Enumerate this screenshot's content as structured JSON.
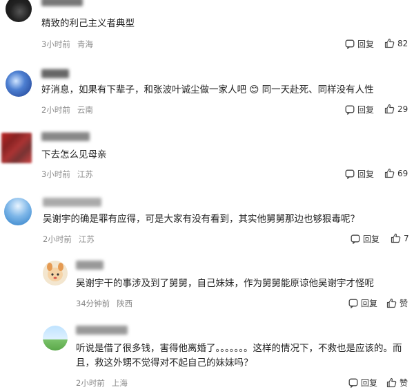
{
  "comments": [
    {
      "text": "精致的利己主义者典型",
      "time": "3小时前",
      "location": "青海",
      "reply": "回复",
      "likes": "82"
    },
    {
      "text": "好消息，如果有下辈子，和张波叶诚尘做一家人吧 😊 同一天赴死、同样没有人性",
      "time": "2小时前",
      "location": "云南",
      "reply": "回复",
      "likes": "29"
    },
    {
      "text": "下去怎么见母亲",
      "time": "3小时前",
      "location": "江苏",
      "reply": "回复",
      "likes": "69"
    },
    {
      "text": "吴谢宇的确是罪有应得，可是大家有没有看到，其实他舅舅那边也够狠毒呢？",
      "time": "2小时前",
      "location": "江苏",
      "reply": "回复",
      "likes": "7"
    },
    {
      "text": "吴谢宇干的事涉及到了舅舅，自己妹妹，作为舅舅能原谅他吴谢宇才怪呢",
      "time": "34分钟前",
      "location": "陕西",
      "reply": "回复",
      "likes": "赞"
    },
    {
      "text_line1": "听说是借了很多钱，害得他离婚了。。。。。。。这样的情况下，不救也是应该的。而",
      "text_line2": "且，救这外甥不觉得对不起自己的妹妹吗？",
      "time": "2小时前",
      "location": "上海",
      "reply": "回复",
      "likes": "赞"
    }
  ]
}
